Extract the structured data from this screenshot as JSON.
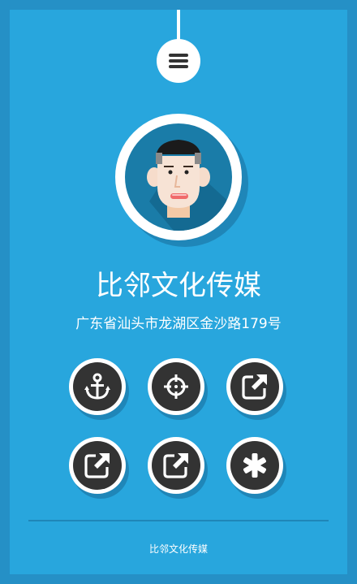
{
  "header": {
    "menu_icon": "hamburger-menu-icon"
  },
  "profile": {
    "avatar_icon": "cartoon-face-avatar",
    "title": "比邻文化传媒",
    "address": "广东省汕头市龙湖区金沙路179号"
  },
  "actions": [
    {
      "icon": "anchor-icon"
    },
    {
      "icon": "crosshair-target-icon"
    },
    {
      "icon": "external-link-icon"
    },
    {
      "icon": "external-link-icon"
    },
    {
      "icon": "external-link-icon"
    },
    {
      "icon": "asterisk-icon"
    }
  ],
  "footer": {
    "text": "比邻文化传媒"
  },
  "colors": {
    "page_border": "#2590c6",
    "background": "#28a6dd",
    "button_core": "#333333",
    "shadow": "#1f86b8",
    "white": "#ffffff"
  }
}
